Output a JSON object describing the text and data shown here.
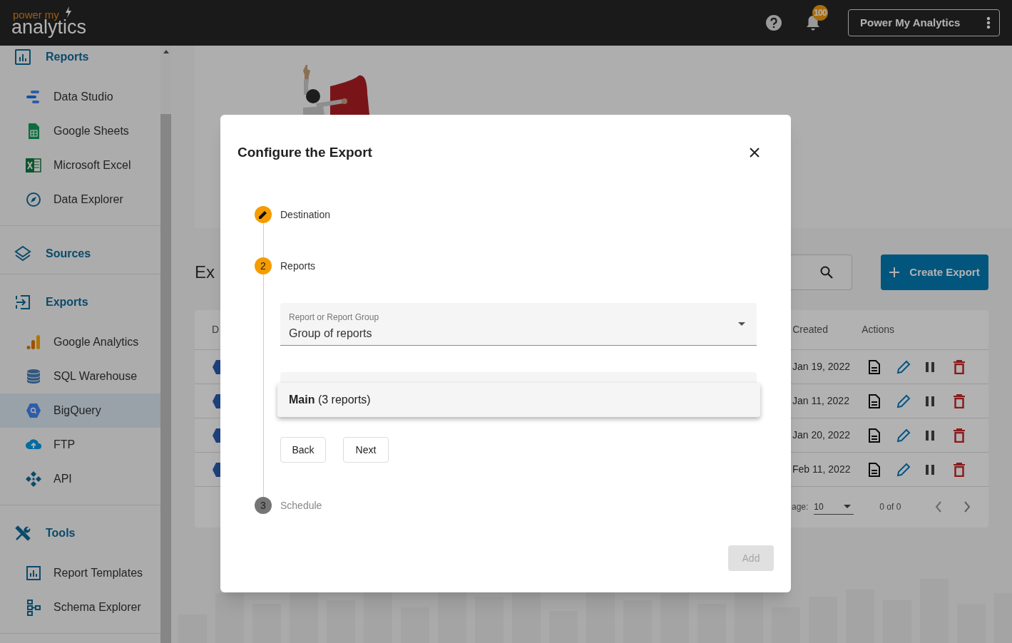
{
  "header": {
    "logo": {
      "word_1": "power",
      "word_2": "my",
      "word_3": "analytics"
    },
    "notifications_badge": "100",
    "account_button": "Power My Analytics"
  },
  "sidebar": {
    "sections": [
      {
        "label": "Reports",
        "children": [
          {
            "label": "Data Studio",
            "selected": false
          },
          {
            "label": "Google Sheets",
            "selected": false
          },
          {
            "label": "Microsoft Excel",
            "selected": false
          },
          {
            "label": "Data Explorer",
            "selected": false
          }
        ]
      },
      {
        "label": "Sources"
      },
      {
        "label": "Exports",
        "children": [
          {
            "label": "Google Analytics",
            "selected": false
          },
          {
            "label": "SQL Warehouse",
            "selected": false
          },
          {
            "label": "BigQuery",
            "selected": true
          },
          {
            "label": "FTP",
            "selected": false
          },
          {
            "label": "API",
            "selected": false
          }
        ]
      },
      {
        "label": "Tools",
        "children": [
          {
            "label": "Report Templates",
            "selected": false
          },
          {
            "label": "Schema Explorer",
            "selected": false
          }
        ]
      }
    ]
  },
  "main": {
    "title": "Ex",
    "create_button": "Create Export",
    "table": {
      "columns": [
        "D",
        "Created",
        "Actions"
      ],
      "rows": [
        {
          "created": "Jan 19, 2022"
        },
        {
          "created": "Jan 11, 2022"
        },
        {
          "created": "Jan 20, 2022"
        },
        {
          "created": "Feb 11, 2022"
        }
      ],
      "pagination": {
        "rows_label": "age:",
        "rows_value": "10",
        "range": "0 of 0"
      }
    }
  },
  "dialog": {
    "title": "Configure the Export",
    "steps": [
      {
        "label": "Destination",
        "kind": "edit",
        "active": true
      },
      {
        "label": "Reports",
        "kind": "number",
        "number": "2",
        "active": true
      },
      {
        "label": "Schedule",
        "kind": "number",
        "number": "3",
        "active": false
      }
    ],
    "select": {
      "label": "Report or Report Group",
      "value": "Group of reports"
    },
    "menu_items": [
      {
        "text": "**Main** (3 reports)"
      }
    ],
    "buttons": [
      {
        "label": "Back"
      },
      {
        "label": "Next"
      }
    ],
    "add_button": {
      "label": "Add",
      "disabled": true
    }
  }
}
